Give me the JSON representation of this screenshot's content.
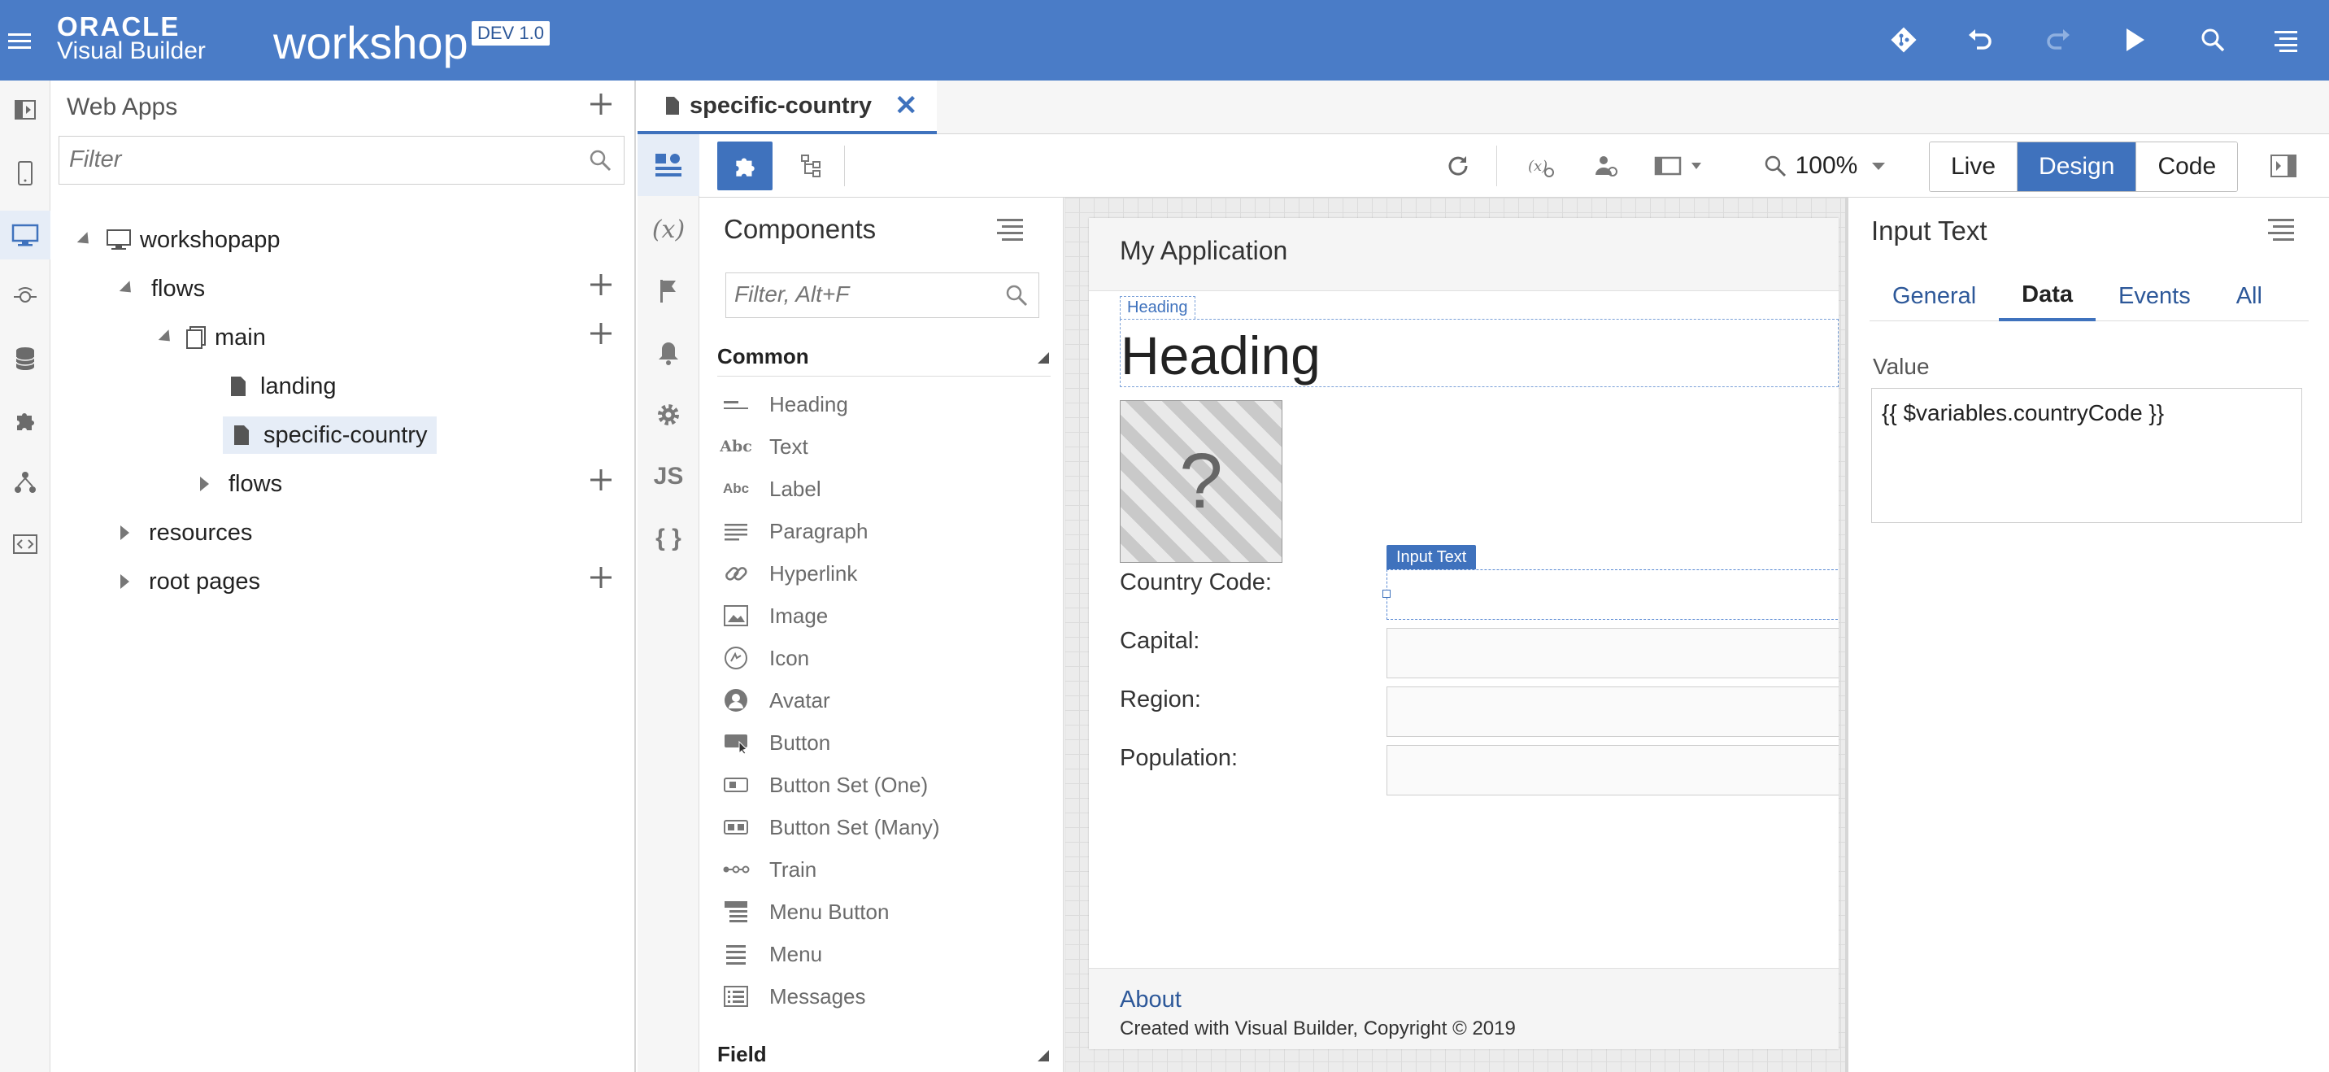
{
  "header": {
    "brand_line1": "ORACLE",
    "brand_line2": "Visual Builder",
    "app_name": "workshop",
    "version": "DEV 1.0",
    "accent_color": "#4a7cc7",
    "icons": [
      "git-icon",
      "undo-icon",
      "redo-icon",
      "run-icon",
      "search-icon",
      "menu-icon"
    ]
  },
  "left_rail": {
    "icons": [
      "navigator-icon",
      "mobile-apps-icon",
      "web-apps-icon",
      "service-connections-icon",
      "business-objects-icon",
      "components-icon",
      "processes-icon",
      "source-icon"
    ]
  },
  "apps_panel": {
    "title": "Web Apps",
    "filter_placeholder": "Filter",
    "tree": {
      "app": "workshopapp",
      "flows": "flows",
      "main": "main",
      "landing": "landing",
      "specific_country": "specific-country",
      "flows2": "flows",
      "resources": "resources",
      "root_pages": "root pages"
    }
  },
  "editor": {
    "tab_label": "specific-country",
    "zoom": "100%",
    "modes": [
      "Live",
      "Design",
      "Code"
    ],
    "active_mode": "Design",
    "rail2_labels": {
      "variables": "(x)",
      "js": "JS",
      "json": "{ }"
    }
  },
  "components": {
    "title": "Components",
    "filter_placeholder": "Filter, Alt+F",
    "section_common": "Common",
    "section_field": "Field",
    "items": [
      "Heading",
      "Text",
      "Label",
      "Paragraph",
      "Hyperlink",
      "Image",
      "Icon",
      "Avatar",
      "Button",
      "Button Set (One)",
      "Button Set (Many)",
      "Train",
      "Menu Button",
      "Menu",
      "Messages"
    ]
  },
  "canvas": {
    "page_title": "My Application",
    "heading_tag": "Heading",
    "heading_text": "Heading",
    "image_placeholder": "?",
    "input_tag": "Input Text",
    "labels": {
      "country_code": "Country Code:",
      "capital": "Capital:",
      "region": "Region:",
      "population": "Population:"
    },
    "footer_about": "About",
    "footer_copy": "Created with Visual Builder, Copyright © 2019"
  },
  "inspector": {
    "title": "Input Text",
    "tabs": [
      "General",
      "Data",
      "Events",
      "All"
    ],
    "active_tab": "Data",
    "value_label": "Value",
    "value": "{{ $variables.countryCode }}"
  }
}
